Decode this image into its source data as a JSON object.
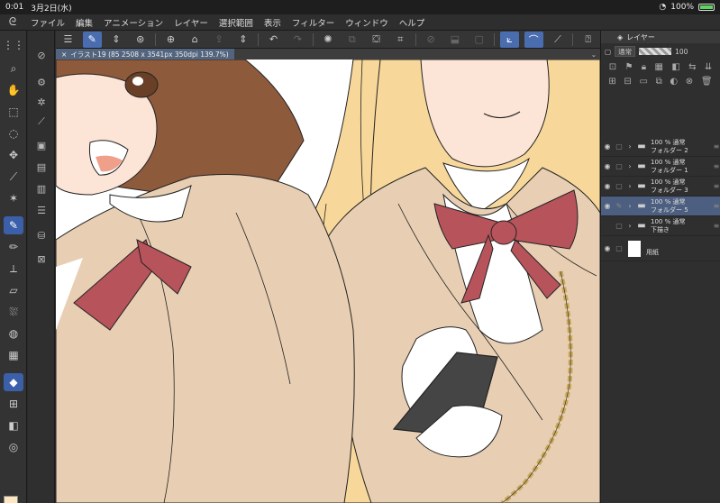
{
  "status": {
    "time": "0:01",
    "date": "3月2日(水)",
    "battery": "100%"
  },
  "menu": {
    "items": [
      "ファイル",
      "編集",
      "アニメーション",
      "レイヤー",
      "選択範囲",
      "表示",
      "フィルター",
      "ウィンドウ",
      "ヘルプ"
    ]
  },
  "document": {
    "tab_title": "イラスト19 (85 2508 x 3541px 350dpi 139.7%)"
  },
  "layer_panel": {
    "title": "レイヤー",
    "blend_mode": "通常",
    "opacity": "100",
    "layers": [
      {
        "line1": "100 % 通常",
        "line2": "フォルダー 2",
        "selected": false
      },
      {
        "line1": "100 % 通常",
        "line2": "フォルダー 1",
        "selected": false
      },
      {
        "line1": "100 % 通常",
        "line2": "フォルダー 3",
        "selected": false
      },
      {
        "line1": "100 % 通常",
        "line2": "フォルダー 5",
        "selected": true
      },
      {
        "line1": "100 % 通常",
        "line2": "下描き",
        "selected": false
      },
      {
        "line1": "",
        "line2": "用紙",
        "selected": false
      }
    ]
  },
  "colors": {
    "accent": "#3b5fa8",
    "main_color": "#fde6c0",
    "selected_layer": "#4d5f80"
  }
}
